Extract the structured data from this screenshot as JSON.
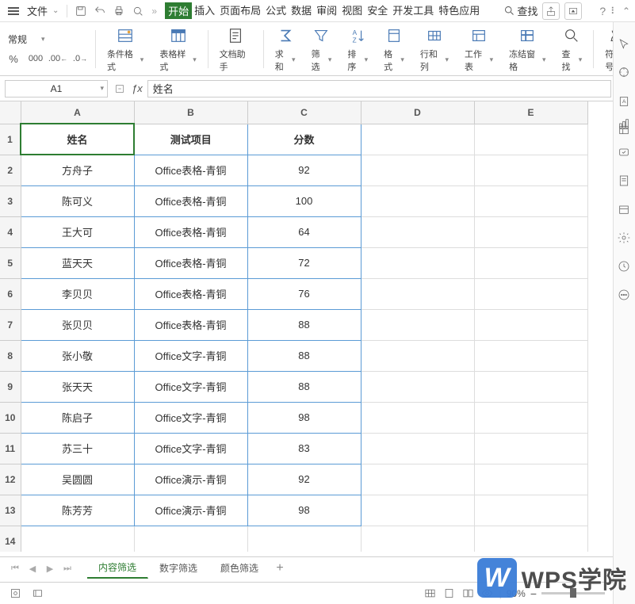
{
  "menu": {
    "file": "文件"
  },
  "tabs": {
    "start": "开始",
    "insert": "插入",
    "layout": "页面布局",
    "formula": "公式",
    "data": "数据",
    "review": "审阅",
    "view": "视图",
    "security": "安全",
    "dev": "开发工具",
    "special": "特色应用"
  },
  "search": "查找",
  "format_select": "常规",
  "ribbon": {
    "condfmt": "条件格式",
    "tablefmt": "表格样式",
    "dochelper": "文档助手",
    "sum": "求和",
    "filter": "筛选",
    "sort": "排序",
    "format": "格式",
    "rowcol": "行和列",
    "worksheet": "工作表",
    "freeze": "冻结窗格",
    "find": "查找",
    "symbol": "符号"
  },
  "cell_ref": "A1",
  "fx_value": "姓名",
  "cols": [
    "A",
    "B",
    "C",
    "D",
    "E"
  ],
  "rows": [
    "1",
    "2",
    "3",
    "4",
    "5",
    "6",
    "7",
    "8",
    "9",
    "10",
    "11",
    "12",
    "13",
    "14"
  ],
  "headers": {
    "a": "姓名",
    "b": "测试项目",
    "c": "分数"
  },
  "chart_data": {
    "type": "table",
    "columns": [
      "姓名",
      "测试项目",
      "分数"
    ],
    "rows": [
      [
        "方舟子",
        "Office表格-青铜",
        "92"
      ],
      [
        "陈可义",
        "Office表格-青铜",
        "100"
      ],
      [
        "王大可",
        "Office表格-青铜",
        "64"
      ],
      [
        "蓝天天",
        "Office表格-青铜",
        "72"
      ],
      [
        "李贝贝",
        "Office表格-青铜",
        "76"
      ],
      [
        "张贝贝",
        "Office表格-青铜",
        "88"
      ],
      [
        "张小敬",
        "Office文字-青铜",
        "88"
      ],
      [
        "张天天",
        "Office文字-青铜",
        "88"
      ],
      [
        "陈启子",
        "Office文字-青铜",
        "98"
      ],
      [
        "苏三十",
        "Office文字-青铜",
        "83"
      ],
      [
        "吴圆圆",
        "Office演示-青铜",
        "92"
      ],
      [
        "陈芳芳",
        "Office演示-青铜",
        "98"
      ]
    ]
  },
  "sheet_tabs": {
    "t1": "内容筛选",
    "t2": "数字筛选",
    "t3": "颜色筛选"
  },
  "zoom": "90%",
  "brand": "WPS学院",
  "brand_logo": "W",
  "decimal_inc": ".00",
  "decimal_dec": ".0",
  "thousand": "000",
  "percent": "%",
  "arrow_l": "←",
  "arrow_r": "→",
  "plus": "+",
  "minus": "−",
  "dash": "—"
}
